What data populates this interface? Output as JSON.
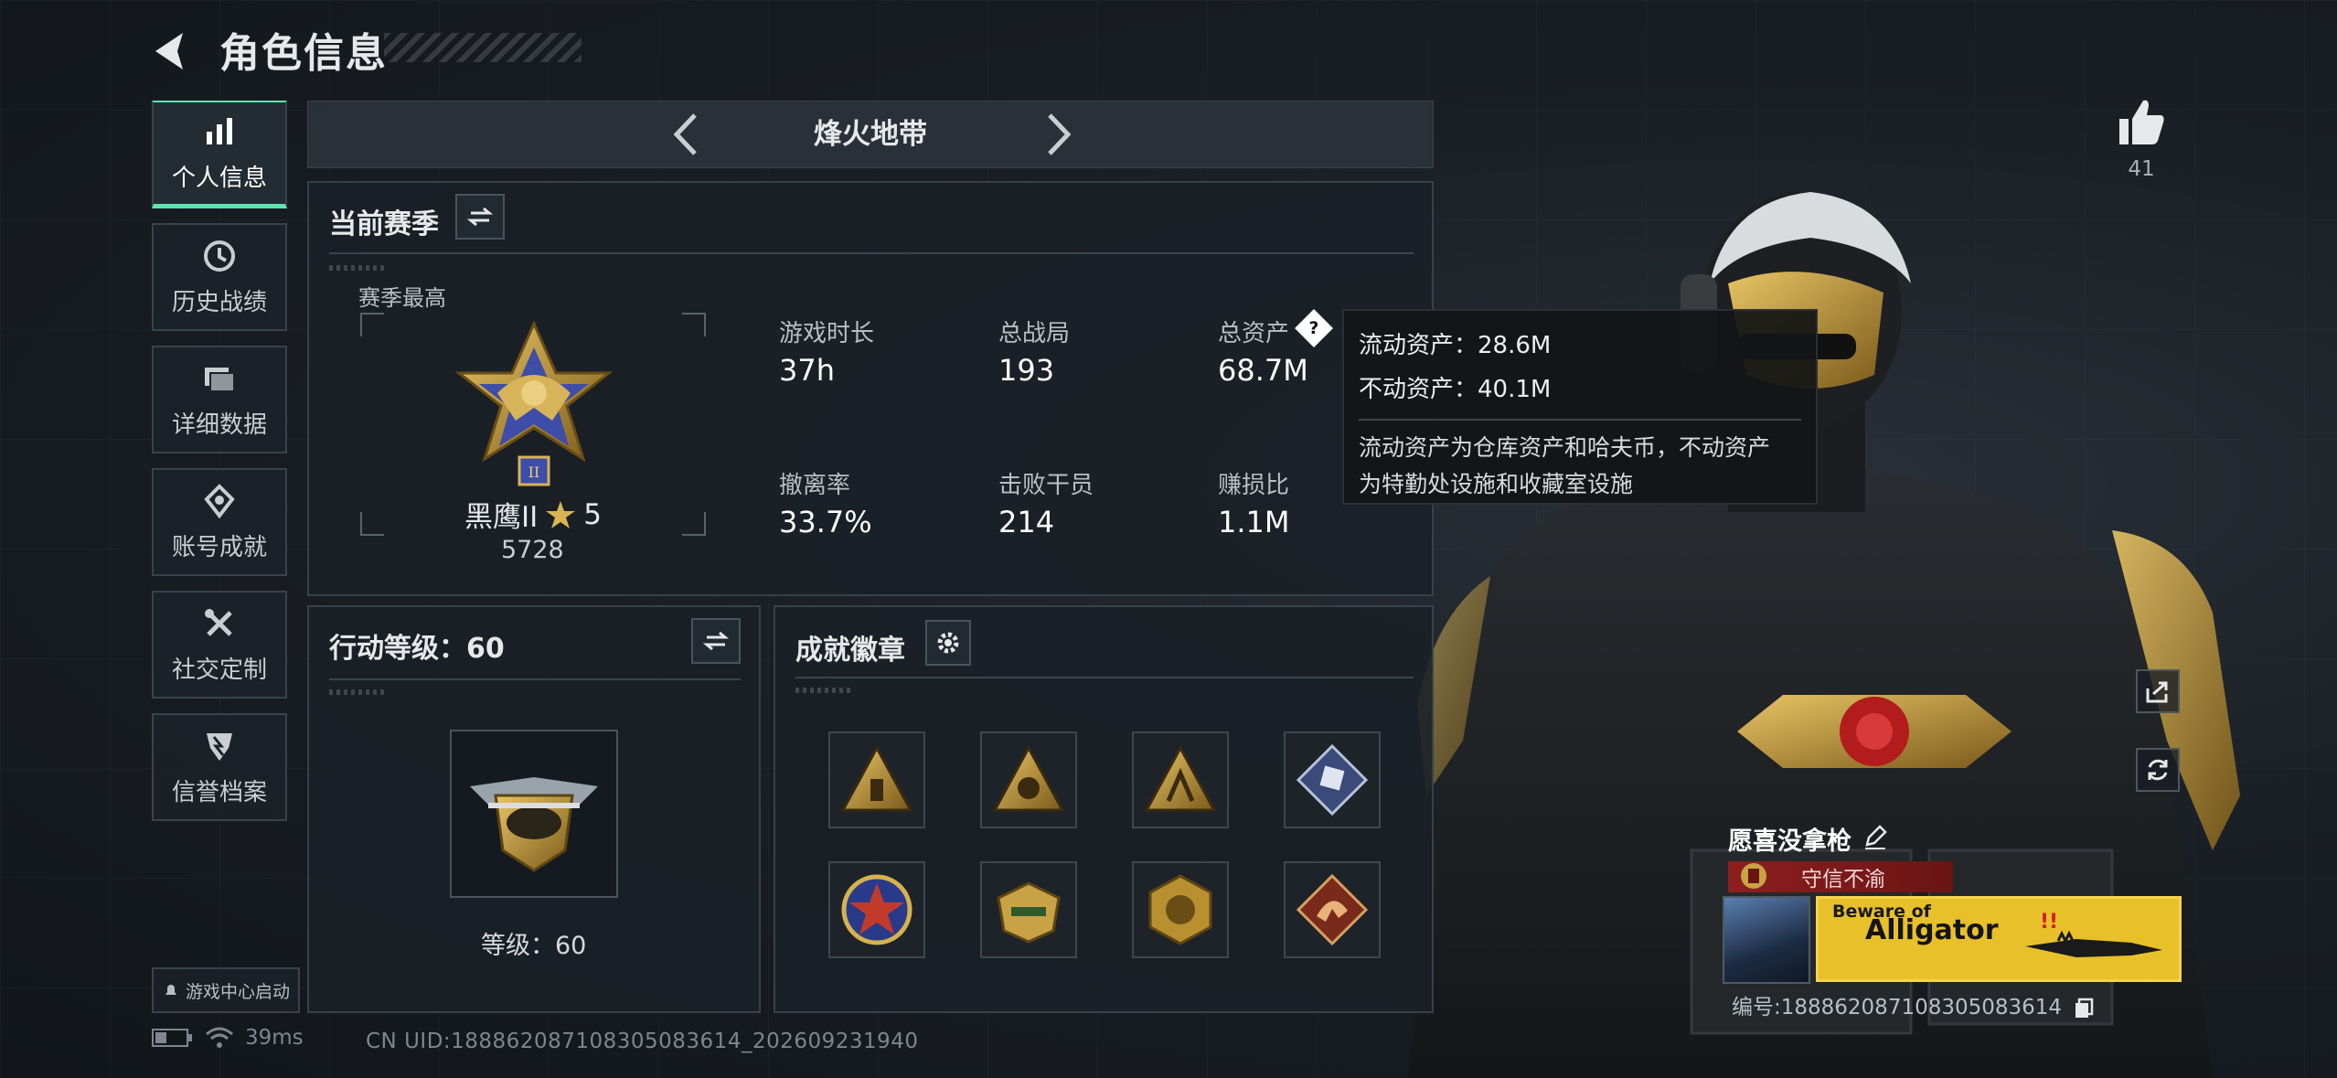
{
  "header": {
    "title": "角色信息"
  },
  "sidebar": {
    "items": [
      {
        "label": "个人信息",
        "icon": "bar-chart-icon",
        "active": true
      },
      {
        "label": "历史战绩",
        "icon": "clock-icon"
      },
      {
        "label": "详细数据",
        "icon": "folder-icon"
      },
      {
        "label": "账号成就",
        "icon": "achievement-icon"
      },
      {
        "label": "社交定制",
        "icon": "tools-icon"
      },
      {
        "label": "信誉档案",
        "icon": "shield-icon"
      }
    ],
    "launch_label": "游戏中心启动"
  },
  "status": {
    "ping": "39ms",
    "uid": "CN UID:18886208710830508​3614_202609231940"
  },
  "mode": {
    "title": "烽火地带"
  },
  "season": {
    "title": "当前赛季",
    "best_label": "赛季最高",
    "rank_name": "黑鹰II",
    "rank_stars": "5",
    "rank_score": "5728",
    "stats": [
      {
        "label": "游戏时长",
        "value": "37h"
      },
      {
        "label": "总战局",
        "value": "193"
      },
      {
        "label": "总资产",
        "value": "68.7M"
      },
      {
        "label": "撤离率",
        "value": "33.7%"
      },
      {
        "label": "击败干员",
        "value": "214"
      },
      {
        "label": "赚损比",
        "value": "1.1M"
      }
    ]
  },
  "tooltip": {
    "liquid": "流动资产：28.6M",
    "fixed": "不动资产：40.1M",
    "desc1": "流动资产为仓库资产和哈夫币，不动资产",
    "desc2": "为特勤处设施和收藏室设施"
  },
  "action_level": {
    "title": "行动等级：60",
    "level_label": "等级：60"
  },
  "badges": {
    "title": "成就徽章"
  },
  "operator": {
    "likes": "41",
    "player_name": "愿喜没拿枪",
    "title_tag": "守信不渝",
    "banner_line1": "Beware of",
    "banner_line2": "Alligator",
    "player_id": "编号:18886208710830508​3614"
  },
  "colors": {
    "accent": "#5fe3b0",
    "gold": "#c9a246",
    "tag_red": "#8d1f1f",
    "banner_yellow": "#e8c02a"
  }
}
